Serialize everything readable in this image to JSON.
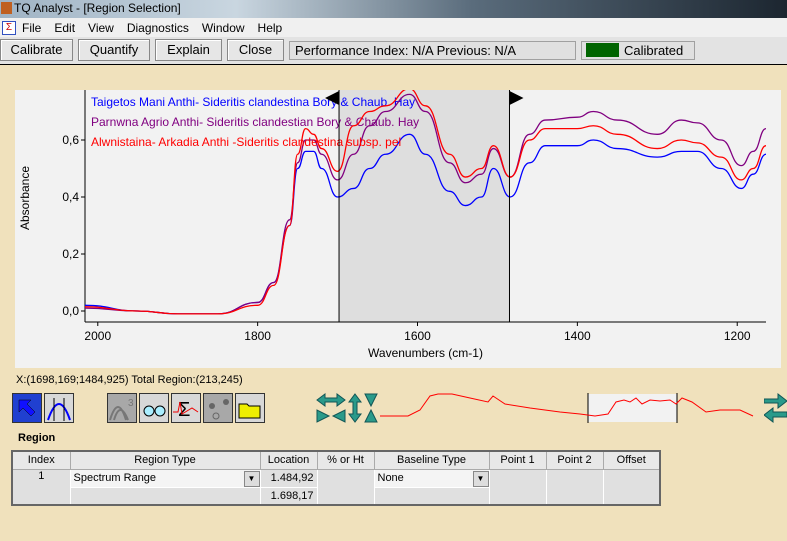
{
  "window": {
    "title": "TQ Analyst  - [Region Selection]"
  },
  "menu": [
    "File",
    "Edit",
    "View",
    "Diagnostics",
    "Window",
    "Help"
  ],
  "toolbar": {
    "calibrate": "Calibrate",
    "quantify": "Quantify",
    "explain": "Explain",
    "close": "Close",
    "performance": "Performance Index:  N/A  Previous:  N/A",
    "status": "Calibrated",
    "status_color": "#006400"
  },
  "chart_data": {
    "type": "line",
    "xlabel": "Wavenumbers (cm-1)",
    "ylabel": "Absorbance",
    "xlim": [
      2016,
      1164
    ],
    "ylim": [
      -0.02,
      0.8
    ],
    "x_reversed": true,
    "xticks": [
      "2000",
      "1800",
      "1600",
      "1400",
      "1200"
    ],
    "xtick_values": [
      2000,
      1800,
      1600,
      1400,
      1200
    ],
    "yticks": [
      "0,0",
      "0,2",
      "0,4",
      "0,6"
    ],
    "ytick_values": [
      0,
      0.2,
      0.4,
      0.6
    ],
    "region": [
      1698.17,
      1484.92
    ],
    "legend_placement": "top-left",
    "x": [
      2016,
      1950,
      1900,
      1850,
      1800,
      1780,
      1760,
      1750,
      1740,
      1730,
      1720,
      1700,
      1680,
      1660,
      1640,
      1610,
      1590,
      1560,
      1540,
      1520,
      1505,
      1484,
      1460,
      1440,
      1400,
      1380,
      1350,
      1300,
      1270,
      1250,
      1220,
      1195,
      1180,
      1164
    ],
    "series": [
      {
        "name": "Taigetos Mani  Anthi- Sideritis clandestina Bory & Chaub. Hay",
        "color": "#0000ff",
        "values": [
          0.02,
          0.0,
          -0.01,
          -0.01,
          0.03,
          0.1,
          0.3,
          0.5,
          0.56,
          0.56,
          0.5,
          0.4,
          0.43,
          0.5,
          0.55,
          0.62,
          0.55,
          0.42,
          0.37,
          0.4,
          0.5,
          0.4,
          0.52,
          0.58,
          0.58,
          0.6,
          0.57,
          0.54,
          0.56,
          0.56,
          0.5,
          0.43,
          0.48,
          0.55
        ]
      },
      {
        "name": "Parnwna Agrio Anthi- Sideritis clandestian Bory & Chaub. Hay",
        "color": "#800080",
        "values": [
          0.01,
          0.0,
          -0.01,
          -0.01,
          0.03,
          0.1,
          0.32,
          0.52,
          0.6,
          0.6,
          0.55,
          0.46,
          0.55,
          0.65,
          0.7,
          0.76,
          0.7,
          0.52,
          0.45,
          0.48,
          0.57,
          0.47,
          0.62,
          0.67,
          0.68,
          0.7,
          0.67,
          0.62,
          0.67,
          0.66,
          0.6,
          0.51,
          0.56,
          0.64
        ]
      },
      {
        "name": "Alwnistaina- Arkadia Anthi -Sideritis clandestina subsp. pel",
        "color": "#ff0000",
        "values": [
          0.015,
          0.0,
          -0.01,
          -0.01,
          0.02,
          0.09,
          0.3,
          0.55,
          0.64,
          0.62,
          0.57,
          0.49,
          0.65,
          0.7,
          0.72,
          0.78,
          0.72,
          0.55,
          0.47,
          0.5,
          0.58,
          0.47,
          0.6,
          0.64,
          0.64,
          0.65,
          0.62,
          0.57,
          0.6,
          0.59,
          0.54,
          0.46,
          0.5,
          0.58
        ]
      }
    ]
  },
  "status_line": "X:(1698,169;1484,925) Total Region:(213,245)",
  "region": {
    "label": "Region",
    "headers": [
      "Index",
      "Region Type",
      "Location",
      "% or Ht",
      "Baseline Type",
      "Point 1",
      "Point 2",
      "Offset"
    ],
    "rows": [
      {
        "index": "1",
        "type": "Spectrum Range",
        "loc1": "1.484,92",
        "loc2": "1.698,17",
        "baseline": "None"
      }
    ]
  }
}
